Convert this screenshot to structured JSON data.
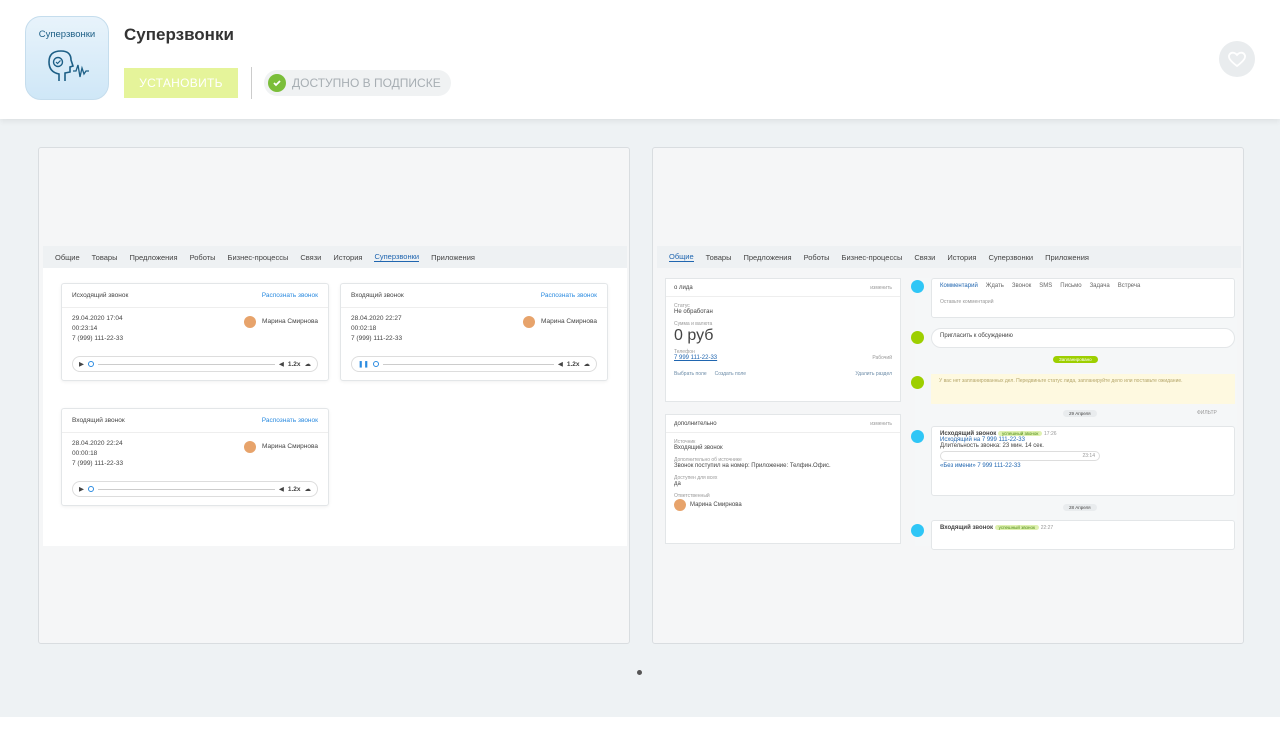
{
  "app": {
    "icon_text": "Суперзвонки",
    "title": "Суперзвонки",
    "install_label": "УСТАНОВИТЬ",
    "subscription_label": "ДОСТУПНО В ПОДПИСКЕ"
  },
  "screenshot1": {
    "tabs": [
      "Общие",
      "Товары",
      "Предложения",
      "Роботы",
      "Бизнес-процессы",
      "Связи",
      "История",
      "Суперзвонки",
      "Приложения"
    ],
    "active_tab": "Суперзвонки",
    "cards": [
      {
        "type": "Исходящий звонок",
        "recognize": "Распознать звонок",
        "date": "29.04.2020 17:04",
        "duration": "00:23:14",
        "phone": "7 (999) 111-22-33",
        "agent": "Марина Смирнова",
        "speed": "1.2x"
      },
      {
        "type": "Входящий звонок",
        "recognize": "Распознать звонок",
        "date": "28.04.2020 22:27",
        "duration": "00:02:18",
        "phone": "7 (999) 111-22-33",
        "agent": "Марина Смирнова",
        "speed": "1.2x"
      },
      {
        "type": "Входящий звонок",
        "recognize": "Распознать звонок",
        "date": "28.04.2020 22:24",
        "duration": "00:00:18",
        "phone": "7 (999) 111-22-33",
        "agent": "Марина Смирнова",
        "speed": "1.2x"
      }
    ]
  },
  "screenshot2": {
    "tabs": [
      "Общие",
      "Товары",
      "Предложения",
      "Роботы",
      "Бизнес-процессы",
      "Связи",
      "История",
      "Суперзвонки",
      "Приложения"
    ],
    "about": {
      "header": "о лида",
      "edit": "изменить",
      "status_label": "Статус",
      "status": "Не обработан",
      "sum_label": "Сумма и валюта",
      "sum": "0 руб",
      "phone_label": "Телефон",
      "phone": "7 999 111-22-33",
      "phone_type": "Рабочий",
      "select_field": "Выбрать поле",
      "create_field": "Создать поле",
      "delete_section": "Удалить раздел"
    },
    "extra": {
      "header": "дополнительно",
      "edit": "изменить",
      "source_label": "Источник",
      "source": "Входящий звонок",
      "source_info_label": "Дополнительно об источнике",
      "source_info": "Звонок поступил на номер: Приложение: Телфин.Офис.",
      "access_label": "Доступен для всех",
      "access": "да",
      "responsible_label": "Ответственный",
      "responsible": "Марина Смирнова"
    },
    "timeline": {
      "tabs": [
        "Комментарий",
        "Ждать",
        "Звонок",
        "SMS",
        "Письмо",
        "Задача",
        "Встреча"
      ],
      "comment_placeholder": "Оставьте комментарий",
      "invite": "Пригласить к обсуждению",
      "planned_badge": "Запланировано",
      "no_tasks": "У вас нет запланированных дел. Передвиньте статус лида, запланируйте дело или поставьте ожидание.",
      "date1": "29 Апреля",
      "filter": "ФИЛЬТР",
      "call1": {
        "title": "Исходящий звонок",
        "tag": "успешный звонок",
        "time": "17:26",
        "number": "Исходящий на 7 999 111-22-33",
        "duration": "Длительность звонка: 23 мин. 14 сек.",
        "audio_time": "23:14",
        "contact": "«Без имени» 7 999 111-22-33"
      },
      "date2": "28 Апреля",
      "call2": {
        "title": "Входящий звонок",
        "tag": "успешный звонок",
        "time": "22:27"
      }
    }
  }
}
